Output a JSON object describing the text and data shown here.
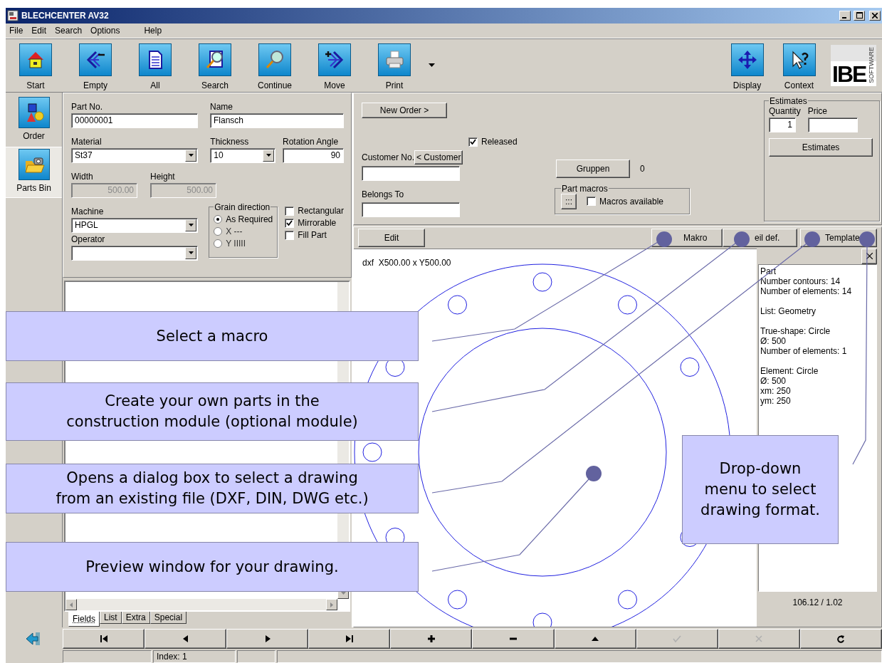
{
  "window": {
    "title": "BLECHCENTER AV32"
  },
  "menu": [
    "File",
    "Edit",
    "Search",
    "Options",
    "Help"
  ],
  "toolbar": {
    "left": [
      {
        "label": "Start"
      },
      {
        "label": "Empty"
      },
      {
        "label": "All"
      },
      {
        "label": "Search"
      },
      {
        "label": "Continue"
      },
      {
        "label": "Move"
      },
      {
        "label": "Print"
      }
    ],
    "right": [
      {
        "label": "Display"
      },
      {
        "label": "Context"
      }
    ]
  },
  "logo": {
    "text": "IBE",
    "subtext": "SOFTWARE"
  },
  "sidebar": [
    {
      "label": "Order",
      "selected": false
    },
    {
      "label": "Parts Bin",
      "selected": true
    }
  ],
  "form": {
    "part_no": {
      "label": "Part No.",
      "value": "00000001"
    },
    "name": {
      "label": "Name",
      "value": "Flansch"
    },
    "material": {
      "label": "Material",
      "value": "St37"
    },
    "thickness": {
      "label": "Thickness",
      "value": "10"
    },
    "rotation_angle": {
      "label": "Rotation Angle",
      "value": "90"
    },
    "width": {
      "label": "Width",
      "value": "500.00",
      "disabled": true
    },
    "height": {
      "label": "Height",
      "value": "500.00",
      "disabled": true
    },
    "machine": {
      "label": "Machine",
      "value": "HPGL"
    },
    "operator": {
      "label": "Operator"
    },
    "grain_direction": {
      "title": "Grain direction",
      "options": [
        {
          "label": "As Required",
          "selected": true
        },
        {
          "label": "X ---",
          "selected": false
        },
        {
          "label": "Y IIIII",
          "selected": false
        }
      ]
    },
    "options": [
      {
        "label": "Rectangular",
        "checked": false
      },
      {
        "label": "Mirrorable",
        "checked": true
      },
      {
        "label": "Fill Part",
        "checked": false
      }
    ]
  },
  "order": {
    "new_order_button": "New Order >",
    "released": {
      "label": "Released",
      "checked": true
    },
    "customer_no": {
      "label": "Customer No."
    },
    "customer_button": "< Customer",
    "belongs_to": {
      "label": "Belongs To"
    },
    "groups_button": "Gruppen",
    "groups_count": "0",
    "part_macros": {
      "title": "Part macros",
      "button": ":::",
      "checkbox": {
        "label": "Macros available",
        "checked": false
      }
    }
  },
  "estimates": {
    "title": "Estimates",
    "quantity_label": "Quantity",
    "quantity": "1",
    "price_label": "Price",
    "button": "Estimates"
  },
  "preview": {
    "buttons": [
      "Edit",
      "Makro",
      "eil def.",
      "Template"
    ],
    "dimensions": "dxf  X500.00 x Y500.00",
    "info": [
      [
        "Part",
        "Number contours: 14",
        "Number of elements: 14"
      ],
      [
        "List: Geometry"
      ],
      [
        "True-shape: Circle",
        "Ø: 500",
        "Number of elements: 1"
      ],
      [
        "Element: Circle",
        "Ø: 500",
        "xm: 250",
        "ym: 250"
      ]
    ],
    "coordinates": "106.12 / 1.02"
  },
  "tabs": [
    {
      "label": "Fields",
      "selected": true
    },
    {
      "label": "List",
      "selected": false
    },
    {
      "label": "Extra",
      "selected": false
    },
    {
      "label": "Special",
      "selected": false
    }
  ],
  "nav": [
    {
      "disabled": false
    },
    {
      "disabled": false
    },
    {
      "disabled": false
    },
    {
      "disabled": false
    },
    {
      "disabled": false
    },
    {
      "disabled": false
    },
    {
      "disabled": false
    },
    {
      "disabled": true
    },
    {
      "disabled": true
    },
    {
      "disabled": false
    }
  ],
  "status_bar": {
    "index": "Index: 1"
  },
  "callouts": [
    {
      "lines": [
        "Select a macro"
      ]
    },
    {
      "lines": [
        "Create your own parts in the",
        "construction module (optional module)"
      ]
    },
    {
      "lines": [
        "Opens a dialog box to select a drawing",
        "from an existing file (DXF, DIN, DWG etc.)"
      ]
    },
    {
      "lines": [
        "Preview window for your drawing."
      ]
    },
    {
      "lines": [
        "Drop-down",
        "menu to select",
        "drawing format."
      ]
    }
  ]
}
